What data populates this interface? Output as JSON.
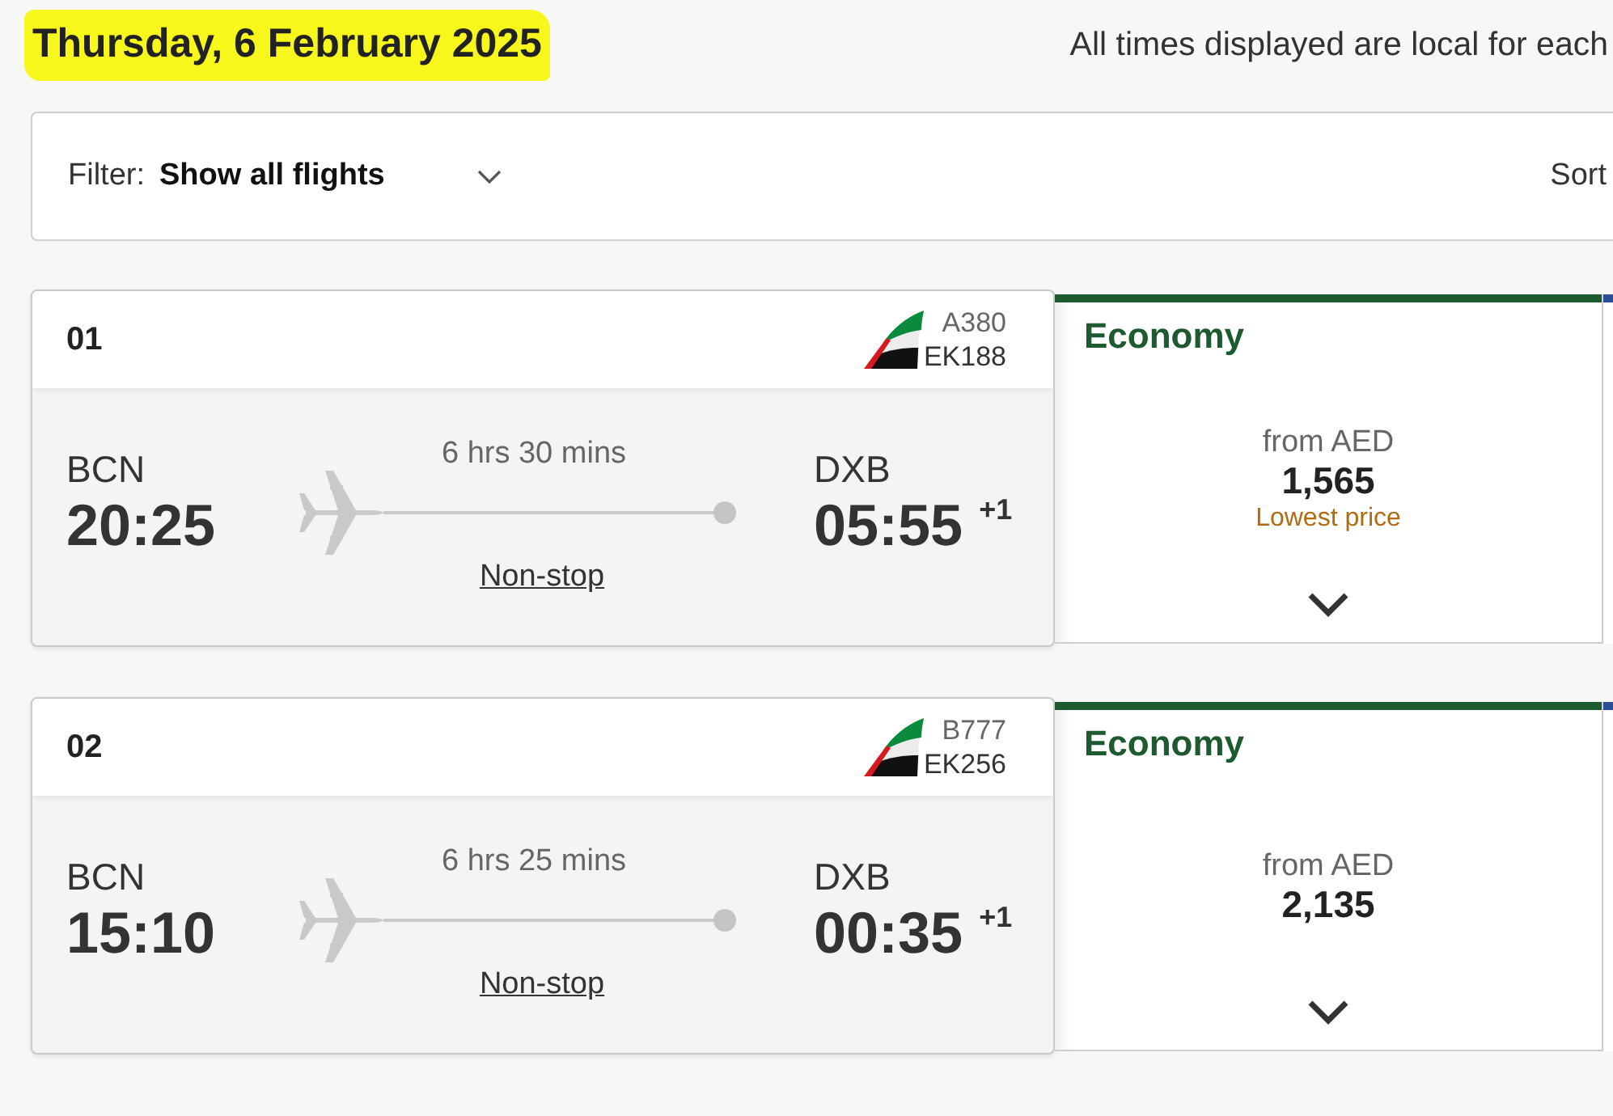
{
  "date_heading": {
    "text": "Thursday, 6 February 2025",
    "highlighted": true
  },
  "timezone_note": "All times displayed are local for each",
  "filter_bar": {
    "label": "Filter:",
    "value": "Show all flights",
    "sort_label": "Sort"
  },
  "flights": [
    {
      "index": "01",
      "aircraft": "A380",
      "flight_number": "EK188",
      "origin": "BCN",
      "departure": "20:25",
      "duration": "6 hrs 30 mins",
      "stops": "Non-stop",
      "destination": "DXB",
      "arrival": "05:55",
      "day_offset": "+1",
      "fares": [
        {
          "kind": "panel",
          "cabin": "Economy",
          "color": "#1e5a30",
          "price_prefix": "from AED",
          "price": "1,565",
          "badge": "Lowest price"
        },
        {
          "kind": "sliver",
          "color": "#2d4e96"
        }
      ]
    },
    {
      "index": "02",
      "aircraft": "B777",
      "flight_number": "EK256",
      "origin": "BCN",
      "departure": "15:10",
      "duration": "6 hrs 25 mins",
      "stops": "Non-stop",
      "destination": "DXB",
      "arrival": "00:35",
      "day_offset": "+1",
      "fares": [
        {
          "kind": "panel",
          "cabin": "Economy",
          "color": "#1e5a30",
          "price_prefix": "from AED",
          "price": "2,135"
        },
        {
          "kind": "sliver",
          "color": "#2d4e96"
        }
      ]
    }
  ]
}
